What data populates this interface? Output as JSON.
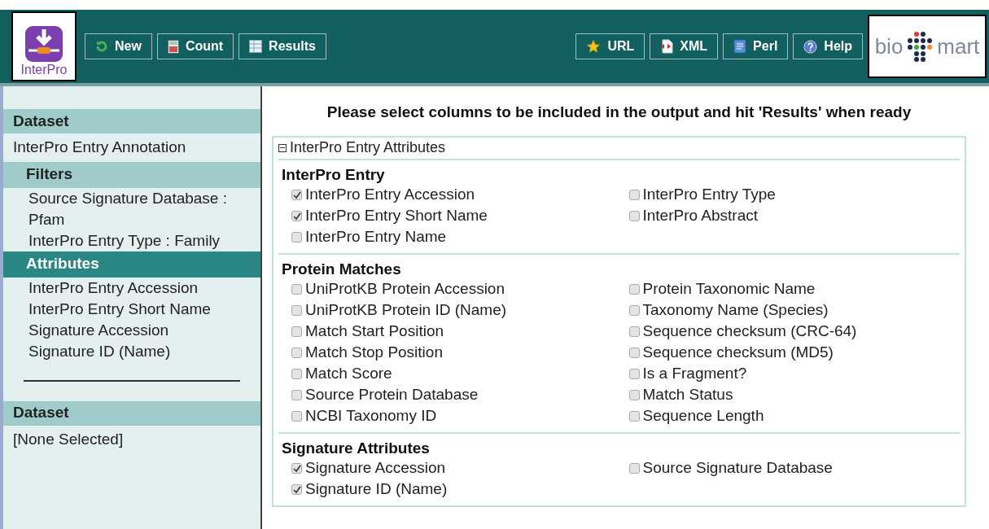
{
  "header": {
    "logo_text": "InterPro",
    "left_buttons": [
      {
        "label": "New",
        "kind": "refresh"
      },
      {
        "label": "Count",
        "kind": "calculator"
      },
      {
        "label": "Results",
        "kind": "table"
      }
    ],
    "right_buttons": [
      {
        "label": "URL",
        "kind": "star"
      },
      {
        "label": "XML",
        "kind": "xml"
      },
      {
        "label": "Perl",
        "kind": "script"
      },
      {
        "label": "Help",
        "kind": "help"
      }
    ],
    "brand": {
      "left": "bio",
      "right": "mart"
    }
  },
  "sidebar": [
    {
      "kind": "header",
      "label": "Dataset"
    },
    {
      "kind": "item",
      "label": "InterPro Entry Annotation"
    },
    {
      "kind": "subheader",
      "label": "Filters",
      "selected": false
    },
    {
      "kind": "subitem",
      "label": "Source Signature Database : Pfam"
    },
    {
      "kind": "subitem",
      "label": "InterPro Entry Type : Family"
    },
    {
      "kind": "subheader",
      "label": "Attributes",
      "selected": true
    },
    {
      "kind": "subitem",
      "label": "InterPro Entry Accession"
    },
    {
      "kind": "subitem",
      "label": "InterPro Entry Short Name"
    },
    {
      "kind": "subitem",
      "label": "Signature Accession"
    },
    {
      "kind": "subitem",
      "label": "Signature ID (Name)"
    },
    {
      "kind": "divider"
    },
    {
      "kind": "header",
      "label": "Dataset"
    },
    {
      "kind": "item",
      "label": "[None Selected]"
    }
  ],
  "main": {
    "title": "Please select columns to be included in the output and hit 'Results' when ready",
    "panel": {
      "title": "InterPro Entry Attributes",
      "expanded": true,
      "groups": [
        {
          "title": "InterPro Entry",
          "left": [
            {
              "label": "InterPro Entry Accession",
              "checked": true
            },
            {
              "label": "InterPro Entry Short Name",
              "checked": true
            },
            {
              "label": "InterPro Entry Name",
              "checked": false
            }
          ],
          "right": [
            {
              "label": "InterPro Entry Type",
              "checked": false
            },
            {
              "label": "InterPro Abstract",
              "checked": false
            }
          ]
        },
        {
          "title": "Protein Matches",
          "left": [
            {
              "label": "UniProtKB Protein Accession",
              "checked": false
            },
            {
              "label": "UniProtKB Protein ID (Name)",
              "checked": false
            },
            {
              "label": "Match Start Position",
              "checked": false
            },
            {
              "label": "Match Stop Position",
              "checked": false
            },
            {
              "label": "Match Score",
              "checked": false
            },
            {
              "label": "Source Protein Database",
              "checked": false
            },
            {
              "label": "NCBI Taxonomy ID",
              "checked": false
            }
          ],
          "right": [
            {
              "label": "Protein Taxonomic Name",
              "checked": false
            },
            {
              "label": "Taxonomy Name (Species)",
              "checked": false
            },
            {
              "label": "Sequence checksum (CRC-64)",
              "checked": false
            },
            {
              "label": "Sequence checksum (MD5)",
              "checked": false
            },
            {
              "label": "Is a Fragment?",
              "checked": false
            },
            {
              "label": "Match Status",
              "checked": false
            },
            {
              "label": "Sequence Length",
              "checked": false
            }
          ]
        },
        {
          "title": "Signature Attributes",
          "left": [
            {
              "label": "Signature Accession",
              "checked": true
            },
            {
              "label": "Signature ID (Name)",
              "checked": true
            }
          ],
          "right": [
            {
              "label": "Source Signature Database",
              "checked": false
            }
          ]
        }
      ]
    }
  }
}
